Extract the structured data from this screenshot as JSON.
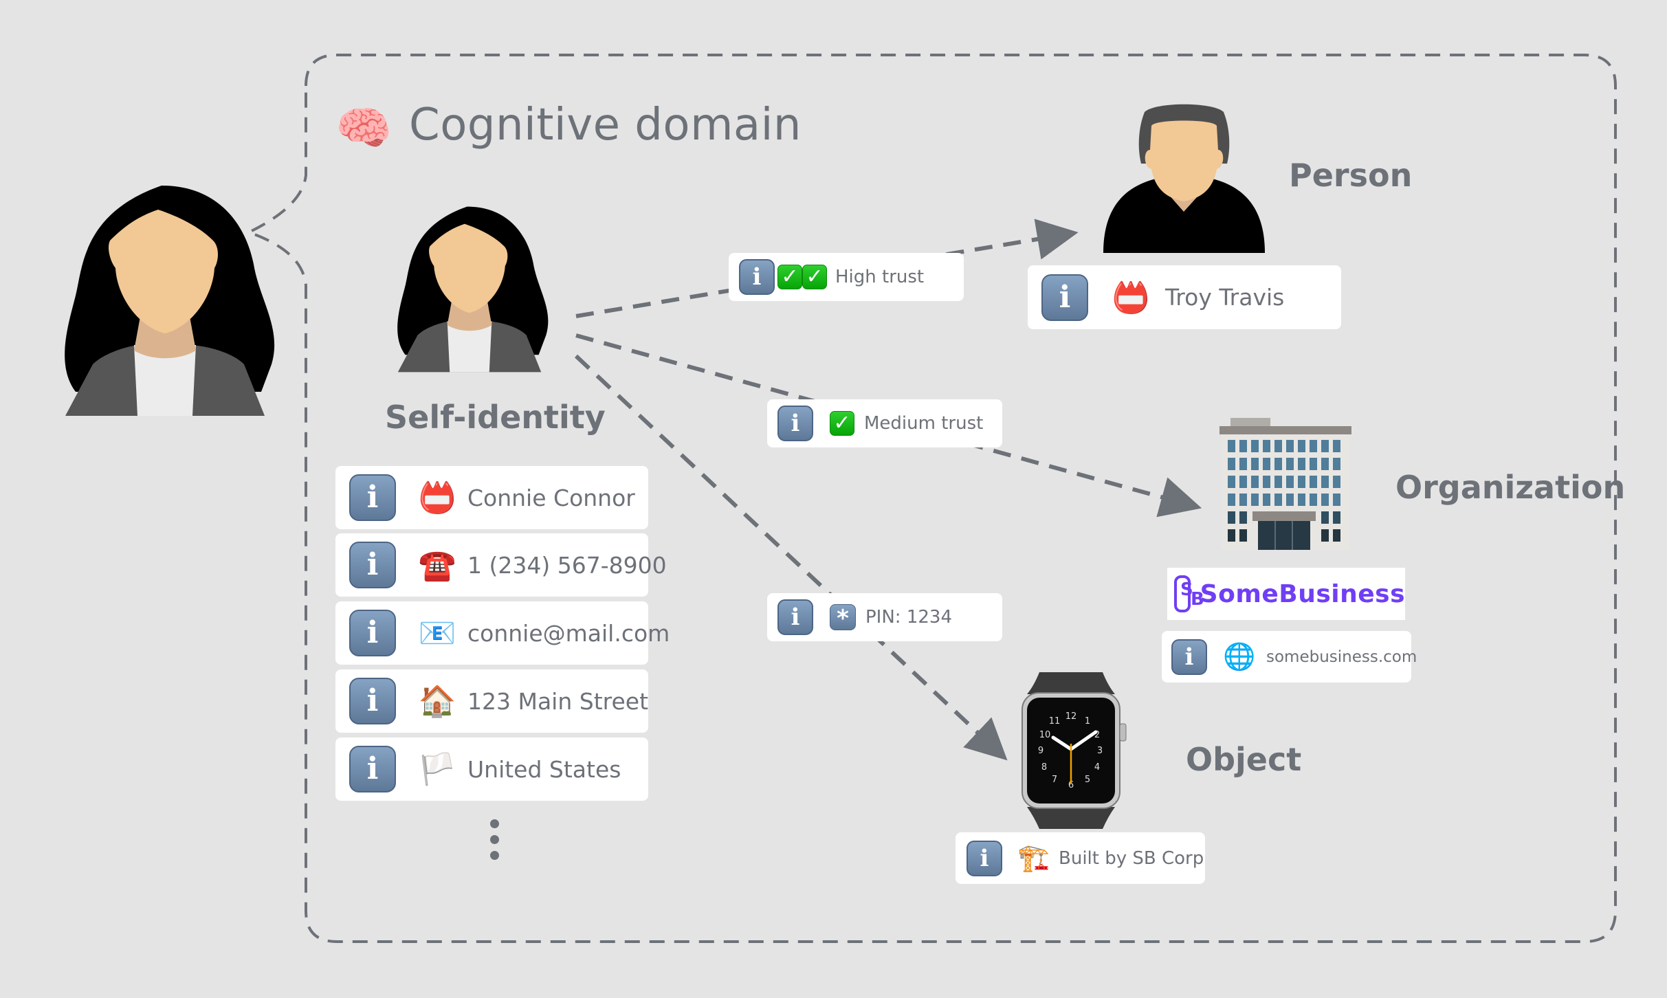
{
  "title": {
    "icon": "brain-icon",
    "text": "Cognitive domain"
  },
  "self": {
    "label": "Self-identity",
    "attributes": [
      {
        "icon": "name-badge-icon",
        "value": "Connie Connor"
      },
      {
        "icon": "telephone-icon",
        "value": "1 (234) 567-8900"
      },
      {
        "icon": "email-icon",
        "value": "connie@mail.com"
      },
      {
        "icon": "house-icon",
        "value": "123 Main Street"
      },
      {
        "icon": "white-flag-icon",
        "value": "United States"
      }
    ],
    "more_indicator": "vertical-ellipsis"
  },
  "relations": [
    {
      "target": "Person",
      "icon": "double-check-icon",
      "label": "High trust"
    },
    {
      "target": "Organization",
      "icon": "check-icon",
      "label": "Medium trust"
    },
    {
      "target": "Object",
      "icon": "asterisk-icon",
      "label": "PIN: 1234",
      "asterisk": "*"
    }
  ],
  "person": {
    "label": "Person",
    "attribute": {
      "icon": "name-badge-icon",
      "value": "Troy Travis"
    }
  },
  "organization": {
    "label": "Organization",
    "logo": {
      "mark_s": "S",
      "mark_b": "B",
      "name": "SomeBusiness",
      "color": "#6f3ef5"
    },
    "attribute": {
      "icon": "globe-icon",
      "value": "somebusiness.com"
    }
  },
  "object": {
    "label": "Object",
    "attribute": {
      "icon": "construction-crane-icon",
      "value": "Built by SB Corp"
    }
  },
  "info_glyph": "i",
  "check_glyph": "✓",
  "colors": {
    "background": "#e4e4e4",
    "line": "#6d7178",
    "text": "#6d7178",
    "brand": "#6f3ef5",
    "info": "#6f8bad"
  }
}
